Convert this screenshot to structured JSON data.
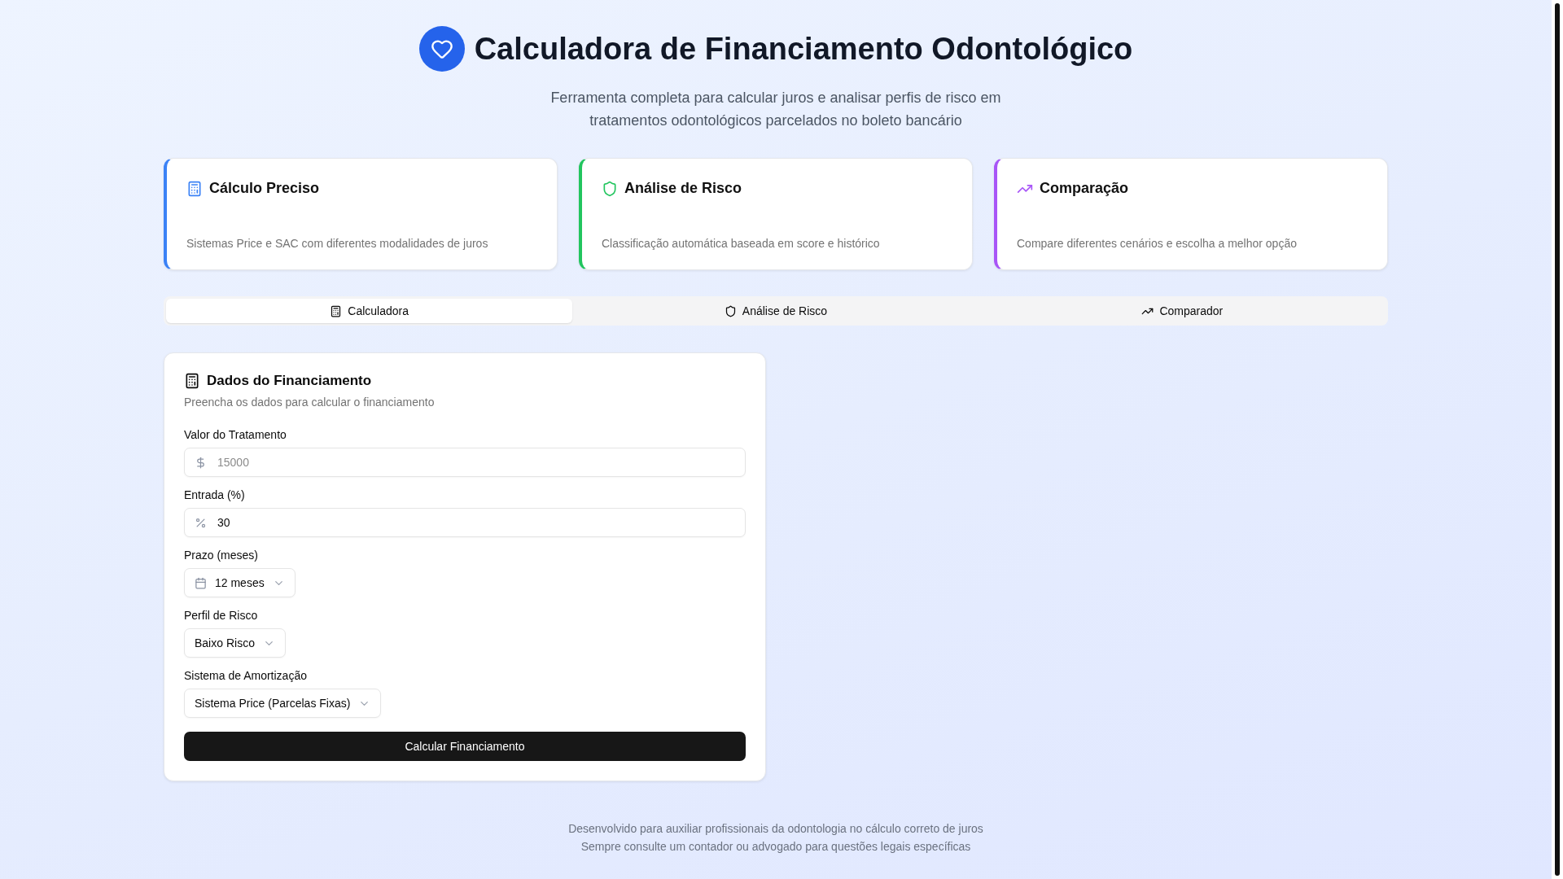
{
  "header": {
    "title": "Calculadora de Financiamento Odontológico",
    "subtitle": "Ferramenta completa para calcular juros e analisar perfis de risco em tratamentos odontológicos parcelados no boleto bancário"
  },
  "features": [
    {
      "kind": "calculator",
      "title": "Cálculo Preciso",
      "description": "Sistemas Price e SAC com diferentes modalidades de juros",
      "color": "#3b82f6"
    },
    {
      "kind": "shield",
      "title": "Análise de Risco",
      "description": "Classificação automática baseada em score e histórico",
      "color": "#22c55e"
    },
    {
      "kind": "trend",
      "title": "Comparação",
      "description": "Compare diferentes cenários e escolha a melhor opção",
      "color": "#a855f7"
    }
  ],
  "tabs": [
    {
      "kind": "calculator",
      "label": "Calculadora",
      "selected": true
    },
    {
      "kind": "shield",
      "label": "Análise de Risco",
      "selected": false
    },
    {
      "kind": "trend",
      "label": "Comparador",
      "selected": false
    }
  ],
  "form": {
    "title": "Dados do Financiamento",
    "description": "Preencha os dados para calcular o financiamento",
    "fields": [
      {
        "kind": "money",
        "label": "Valor do Tratamento",
        "placeholder": "15000"
      },
      {
        "kind": "percent",
        "label": "Entrada (%)",
        "value": "30"
      },
      {
        "kind": "date",
        "label": "Prazo (meses)",
        "value": "12 meses"
      },
      {
        "kind": "select",
        "label": "Perfil de Risco",
        "value": "Baixo Risco"
      },
      {
        "kind": "select",
        "label": "Sistema de Amortização",
        "value": "Sistema Price (Parcelas Fixas)"
      }
    ],
    "submit": "Calcular Financiamento"
  },
  "footer": [
    "Desenvolvido para auxiliar profissionais da odontologia no cálculo correto de juros",
    "Sempre consulte um contador ou advogado para questões legais específicas"
  ]
}
